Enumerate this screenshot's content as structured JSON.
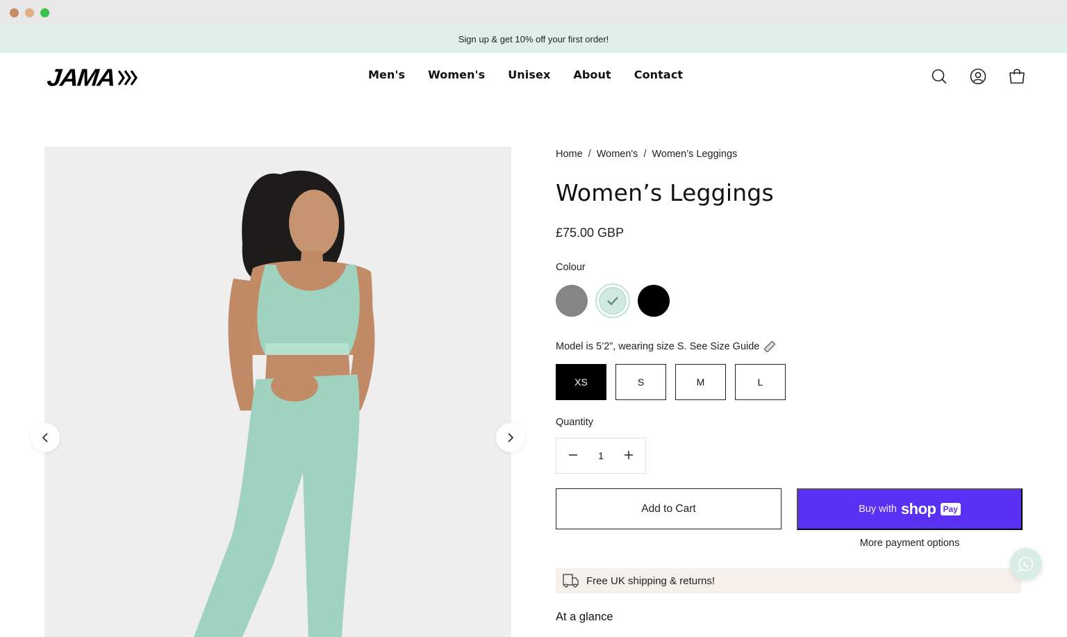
{
  "announcement": "Sign up & get 10% off your first order!",
  "header": {
    "logo_text": "JAMA",
    "nav": [
      "Men's",
      "Women's",
      "Unisex",
      "About",
      "Contact"
    ],
    "icons": [
      "search-icon",
      "account-icon",
      "cart-icon"
    ]
  },
  "gallery": {
    "prev_icon": "chevron-left-icon",
    "next_icon": "chevron-right-icon"
  },
  "product": {
    "breadcrumb": [
      "Home",
      "Women's",
      "Women’s Leggings"
    ],
    "breadcrumb_separator": "/",
    "title": "Women’s Leggings",
    "price": "£75.00 GBP",
    "colour_label": "Colour",
    "colours": [
      {
        "name": "Grey",
        "hex": "#858585",
        "selected": false
      },
      {
        "name": "Mint",
        "hex": "#d2e9e1",
        "selected": true
      },
      {
        "name": "Black",
        "hex": "#000000",
        "selected": false
      }
    ],
    "size_note": "Model is 5’2”, wearing size S. See Size Guide",
    "sizes": [
      {
        "label": "XS",
        "active": true
      },
      {
        "label": "S",
        "active": false
      },
      {
        "label": "M",
        "active": false
      },
      {
        "label": "L",
        "active": false
      }
    ],
    "quantity_label": "Quantity",
    "quantity": "1",
    "add_to_cart": "Add to Cart",
    "shop_pay": {
      "buy": "Buy with",
      "shop": "shop",
      "pay": "Pay",
      "color": "#5a31f4"
    },
    "more_payment": "More payment options",
    "shipping": "Free UK shipping & returns!",
    "at_a_glance": "At a glance"
  },
  "colors": {
    "announcement_bg": "#e0efea",
    "shipping_bg": "#f6efea",
    "accent_shop_pay": "#5a31f4"
  }
}
